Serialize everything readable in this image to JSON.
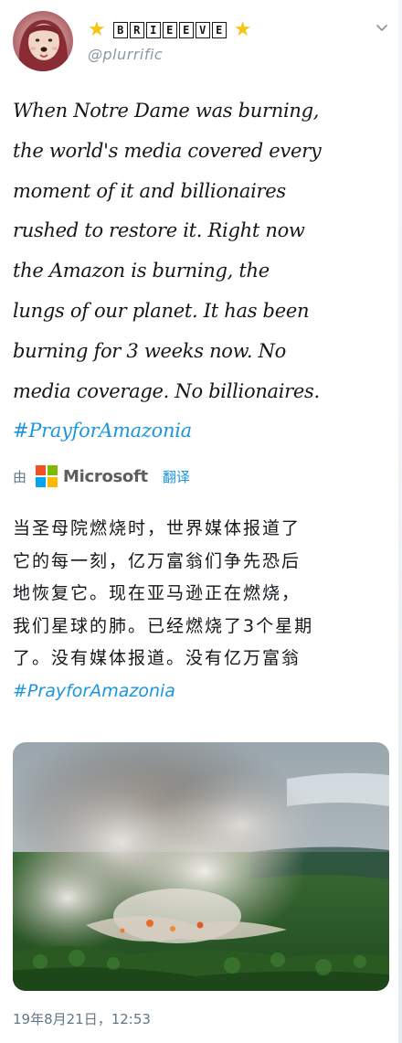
{
  "author": {
    "display_name_letters": [
      "B",
      "R",
      "I",
      "E",
      "E",
      "V",
      "E"
    ],
    "handle": "@plurrific",
    "icons": {
      "left": "star-emoji-icon",
      "right": "star-emoji-icon",
      "menu": "chevron-down-icon"
    }
  },
  "tweet": {
    "text": "When Notre Dame was burning,\nthe world's media covered every\nmoment of it and billionaires\nrushed to restore it. Right now\nthe Amazon is burning, the\nlungs of our planet. It has been\nburning for 3 weeks now. No\nmedia coverage. No billionaires.",
    "hashtag": "#PrayforAmazonia"
  },
  "translation": {
    "by_label": "由",
    "provider": "Microsoft",
    "translate_label": "翻译",
    "text": "当圣母院燃烧时，世界媒体报道了\n它的每一刻，亿万富翁们争先恐后\n地恢复它。现在亚马逊正在燃烧，\n我们星球的肺。已经燃烧了3个星期\n了。没有媒体报道。没有亿万富翁",
    "hashtag": "#PrayforAmazonia"
  },
  "media": {
    "subject": "aerial-photo-amazon-rainforest-fire-smoke"
  },
  "timestamp": "19年8月21日，12:53",
  "colors": {
    "link": "#1b95e0",
    "secondary_text": "#657786",
    "handle": "#8899a6",
    "star": "#f5c518",
    "ms_red": "#f25022",
    "ms_green": "#7fba00",
    "ms_blue": "#00a4ef",
    "ms_yellow": "#ffb900"
  }
}
